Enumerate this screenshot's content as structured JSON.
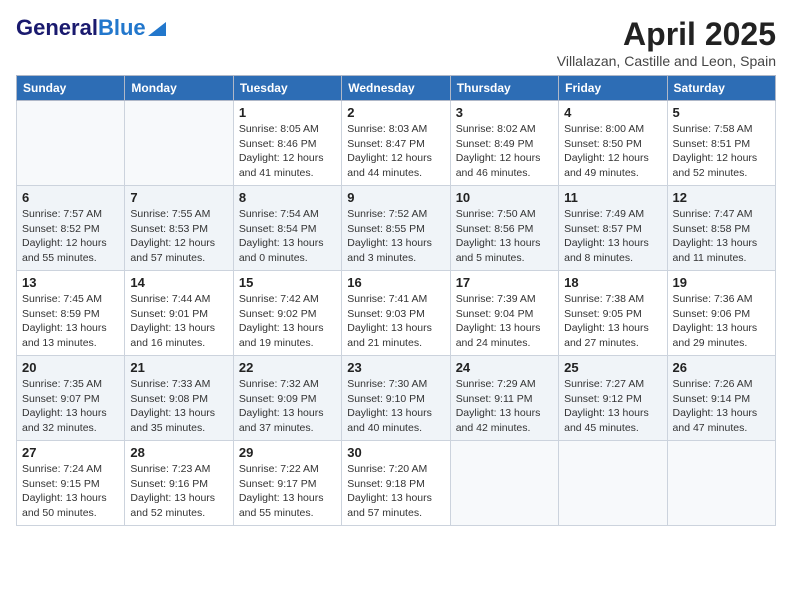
{
  "header": {
    "logo_general": "General",
    "logo_blue": "Blue",
    "month_title": "April 2025",
    "subtitle": "Villalazan, Castille and Leon, Spain"
  },
  "weekdays": [
    "Sunday",
    "Monday",
    "Tuesday",
    "Wednesday",
    "Thursday",
    "Friday",
    "Saturday"
  ],
  "weeks": [
    [
      {
        "day": "",
        "info": ""
      },
      {
        "day": "",
        "info": ""
      },
      {
        "day": "1",
        "info": "Sunrise: 8:05 AM\nSunset: 8:46 PM\nDaylight: 12 hours and 41 minutes."
      },
      {
        "day": "2",
        "info": "Sunrise: 8:03 AM\nSunset: 8:47 PM\nDaylight: 12 hours and 44 minutes."
      },
      {
        "day": "3",
        "info": "Sunrise: 8:02 AM\nSunset: 8:49 PM\nDaylight: 12 hours and 46 minutes."
      },
      {
        "day": "4",
        "info": "Sunrise: 8:00 AM\nSunset: 8:50 PM\nDaylight: 12 hours and 49 minutes."
      },
      {
        "day": "5",
        "info": "Sunrise: 7:58 AM\nSunset: 8:51 PM\nDaylight: 12 hours and 52 minutes."
      }
    ],
    [
      {
        "day": "6",
        "info": "Sunrise: 7:57 AM\nSunset: 8:52 PM\nDaylight: 12 hours and 55 minutes."
      },
      {
        "day": "7",
        "info": "Sunrise: 7:55 AM\nSunset: 8:53 PM\nDaylight: 12 hours and 57 minutes."
      },
      {
        "day": "8",
        "info": "Sunrise: 7:54 AM\nSunset: 8:54 PM\nDaylight: 13 hours and 0 minutes."
      },
      {
        "day": "9",
        "info": "Sunrise: 7:52 AM\nSunset: 8:55 PM\nDaylight: 13 hours and 3 minutes."
      },
      {
        "day": "10",
        "info": "Sunrise: 7:50 AM\nSunset: 8:56 PM\nDaylight: 13 hours and 5 minutes."
      },
      {
        "day": "11",
        "info": "Sunrise: 7:49 AM\nSunset: 8:57 PM\nDaylight: 13 hours and 8 minutes."
      },
      {
        "day": "12",
        "info": "Sunrise: 7:47 AM\nSunset: 8:58 PM\nDaylight: 13 hours and 11 minutes."
      }
    ],
    [
      {
        "day": "13",
        "info": "Sunrise: 7:45 AM\nSunset: 8:59 PM\nDaylight: 13 hours and 13 minutes."
      },
      {
        "day": "14",
        "info": "Sunrise: 7:44 AM\nSunset: 9:01 PM\nDaylight: 13 hours and 16 minutes."
      },
      {
        "day": "15",
        "info": "Sunrise: 7:42 AM\nSunset: 9:02 PM\nDaylight: 13 hours and 19 minutes."
      },
      {
        "day": "16",
        "info": "Sunrise: 7:41 AM\nSunset: 9:03 PM\nDaylight: 13 hours and 21 minutes."
      },
      {
        "day": "17",
        "info": "Sunrise: 7:39 AM\nSunset: 9:04 PM\nDaylight: 13 hours and 24 minutes."
      },
      {
        "day": "18",
        "info": "Sunrise: 7:38 AM\nSunset: 9:05 PM\nDaylight: 13 hours and 27 minutes."
      },
      {
        "day": "19",
        "info": "Sunrise: 7:36 AM\nSunset: 9:06 PM\nDaylight: 13 hours and 29 minutes."
      }
    ],
    [
      {
        "day": "20",
        "info": "Sunrise: 7:35 AM\nSunset: 9:07 PM\nDaylight: 13 hours and 32 minutes."
      },
      {
        "day": "21",
        "info": "Sunrise: 7:33 AM\nSunset: 9:08 PM\nDaylight: 13 hours and 35 minutes."
      },
      {
        "day": "22",
        "info": "Sunrise: 7:32 AM\nSunset: 9:09 PM\nDaylight: 13 hours and 37 minutes."
      },
      {
        "day": "23",
        "info": "Sunrise: 7:30 AM\nSunset: 9:10 PM\nDaylight: 13 hours and 40 minutes."
      },
      {
        "day": "24",
        "info": "Sunrise: 7:29 AM\nSunset: 9:11 PM\nDaylight: 13 hours and 42 minutes."
      },
      {
        "day": "25",
        "info": "Sunrise: 7:27 AM\nSunset: 9:12 PM\nDaylight: 13 hours and 45 minutes."
      },
      {
        "day": "26",
        "info": "Sunrise: 7:26 AM\nSunset: 9:14 PM\nDaylight: 13 hours and 47 minutes."
      }
    ],
    [
      {
        "day": "27",
        "info": "Sunrise: 7:24 AM\nSunset: 9:15 PM\nDaylight: 13 hours and 50 minutes."
      },
      {
        "day": "28",
        "info": "Sunrise: 7:23 AM\nSunset: 9:16 PM\nDaylight: 13 hours and 52 minutes."
      },
      {
        "day": "29",
        "info": "Sunrise: 7:22 AM\nSunset: 9:17 PM\nDaylight: 13 hours and 55 minutes."
      },
      {
        "day": "30",
        "info": "Sunrise: 7:20 AM\nSunset: 9:18 PM\nDaylight: 13 hours and 57 minutes."
      },
      {
        "day": "",
        "info": ""
      },
      {
        "day": "",
        "info": ""
      },
      {
        "day": "",
        "info": ""
      }
    ]
  ]
}
